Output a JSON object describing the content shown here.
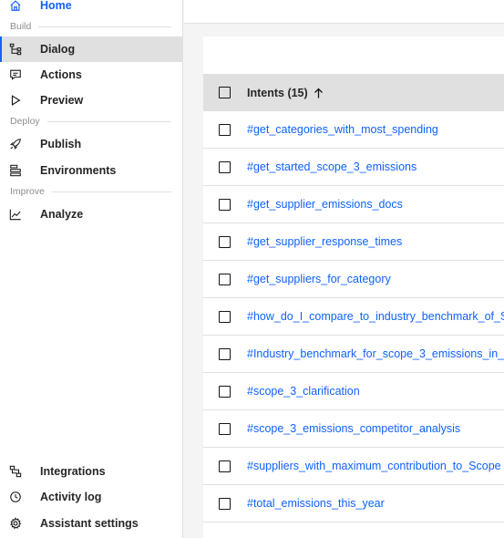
{
  "sidebar": {
    "home": {
      "label": "Home",
      "icon": "home-icon"
    },
    "sections": {
      "build": "Build",
      "deploy": "Deploy",
      "improve": "Improve"
    },
    "items": [
      {
        "key": "dialog",
        "label": "Dialog",
        "icon": "dialog-tree-icon",
        "selected": true
      },
      {
        "key": "actions",
        "label": "Actions",
        "icon": "chat-bubble-icon"
      },
      {
        "key": "preview",
        "label": "Preview",
        "icon": "play-icon"
      },
      {
        "key": "publish",
        "label": "Publish",
        "icon": "rocket-icon"
      },
      {
        "key": "environments",
        "label": "Environments",
        "icon": "server-stack-icon"
      },
      {
        "key": "analyze",
        "label": "Analyze",
        "icon": "line-chart-icon"
      }
    ],
    "bottom_items": [
      {
        "key": "integrations",
        "label": "Integrations",
        "icon": "integrations-icon"
      },
      {
        "key": "activity_log",
        "label": "Activity log",
        "icon": "clock-icon"
      },
      {
        "key": "assistant_settings",
        "label": "Assistant settings",
        "icon": "gear-icon"
      }
    ]
  },
  "table": {
    "header": {
      "title": "Intents (15)",
      "sort_icon": "arrow-up-icon"
    },
    "rows": [
      "#get_categories_with_most_spending",
      "#get_started_scope_3_emissions",
      "#get_supplier_emissions_docs",
      "#get_supplier_response_times",
      "#get_suppliers_for_category",
      "#how_do_I_compare_to_industry_benchmark_of_S",
      "#Industry_benchmark_for_scope_3_emissions_in_",
      "#scope_3_clarification",
      "#scope_3_emissions_competitor_analysis",
      "#suppliers_with_maximum_contribution_to_Scope",
      "#total_emissions_this_year"
    ]
  },
  "colors": {
    "accent": "#0f62fe",
    "selected_bg": "#e0e0e0",
    "header_bg": "#e0e0e0",
    "page_bg": "#f4f4f4"
  }
}
